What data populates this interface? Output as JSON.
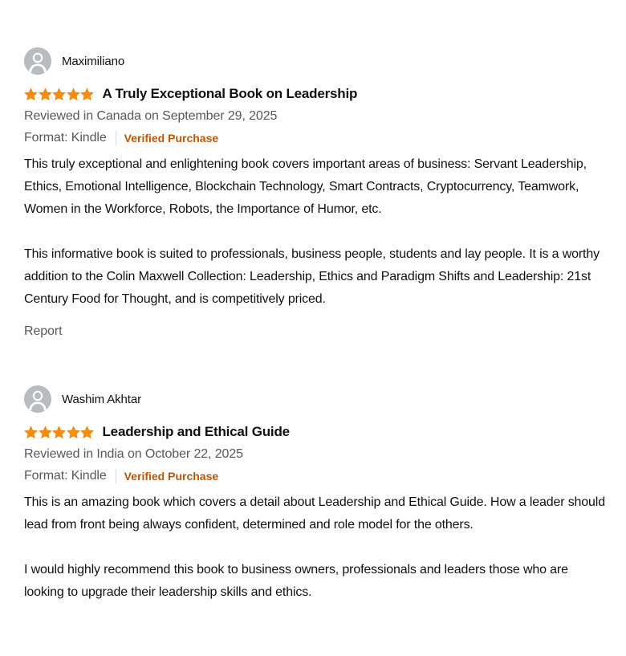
{
  "colors": {
    "star": "#ff8c00",
    "verified": "#c45500",
    "secondary_text": "#565959",
    "primary_text": "#0f1111",
    "avatar": "#b8bcc1"
  },
  "reviews": [
    {
      "author": "Maximiliano",
      "avatar_icon": "default-user-icon",
      "rating": 5,
      "title": "A Truly Exceptional Book on Leadership",
      "date_text": "Reviewed in Canada on September 29, 2025",
      "format_text": "Format: Kindle",
      "badge": "Verified Purchase",
      "body": [
        "This truly exceptional and enlightening book covers important areas of business: Servant Leadership, Ethics, Emotional Intelligence, Blockchain Technology, Smart Contracts, Cryptocurrency, Teamwork, Women in the Workforce, Robots, the Importance of Humor, etc.",
        "This informative book is suited to professionals, business people, students and lay people. It is a worthy addition to the Colin Maxwell Collection: Leadership, Ethics and Paradigm Shifts and Leadership: 21st Century Food for Thought, and is competitively priced."
      ],
      "report_label": "Report"
    },
    {
      "author": "Washim Akhtar",
      "avatar_icon": "default-user-icon",
      "rating": 5,
      "title": "Leadership and Ethical Guide",
      "date_text": "Reviewed in India on October 22, 2025",
      "format_text": "Format: Kindle",
      "badge": "Verified Purchase",
      "body": [
        "This is an amazing book which covers a detail about Leadership and Ethical Guide. How a leader should lead from front being always confident, determined and role model for the others.",
        "I would highly recommend this book to business owners, professionals and leaders those who are looking to upgrade their leadership skills and ethics."
      ]
    }
  ]
}
